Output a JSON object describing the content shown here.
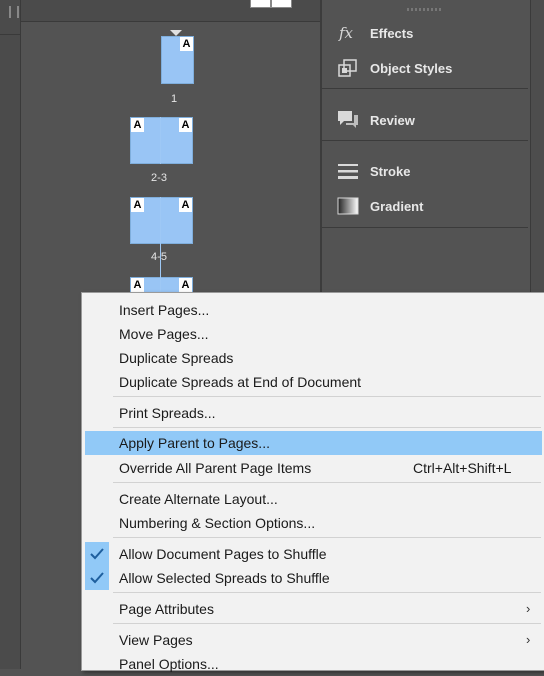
{
  "pages_panel": {
    "spreads": [
      {
        "label": "1",
        "letters": [
          "A"
        ]
      },
      {
        "label": "2-3",
        "letters": [
          "A",
          "A"
        ]
      },
      {
        "label": "4-5",
        "letters": [
          "A",
          "A"
        ]
      },
      {
        "label": "",
        "letters": [
          "A",
          "A"
        ]
      }
    ]
  },
  "right_panels": {
    "groups": [
      {
        "items": [
          {
            "icon": "fx-icon",
            "label": "Effects"
          },
          {
            "icon": "object-styles-icon",
            "label": "Object Styles"
          }
        ]
      },
      {
        "items": [
          {
            "icon": "review-icon",
            "label": "Review"
          }
        ]
      },
      {
        "items": [
          {
            "icon": "stroke-icon",
            "label": "Stroke"
          },
          {
            "icon": "gradient-icon",
            "label": "Gradient"
          }
        ]
      }
    ]
  },
  "context_menu": {
    "items": [
      {
        "label": "Insert Pages..."
      },
      {
        "label": "Move Pages..."
      },
      {
        "label": "Duplicate Spreads"
      },
      {
        "label": "Duplicate Spreads at End of Document"
      },
      {
        "label": "Print Spreads..."
      },
      {
        "label": "Apply Parent to Pages...",
        "highlighted": true
      },
      {
        "label": "Override All Parent Page Items",
        "shortcut": "Ctrl+Alt+Shift+L"
      },
      {
        "label": "Create Alternate Layout..."
      },
      {
        "label": "Numbering & Section Options..."
      },
      {
        "label": "Allow Document Pages to Shuffle",
        "checked": true
      },
      {
        "label": "Allow Selected Spreads to Shuffle",
        "checked": true
      },
      {
        "label": "Page Attributes",
        "submenu": true
      },
      {
        "label": "View Pages",
        "submenu": true
      },
      {
        "label": "Panel Options..."
      }
    ]
  },
  "colors": {
    "highlight": "#91c9f7",
    "page_fill": "#99c5f5",
    "panel_bg": "#535353",
    "menu_bg": "#f2f2f2"
  }
}
